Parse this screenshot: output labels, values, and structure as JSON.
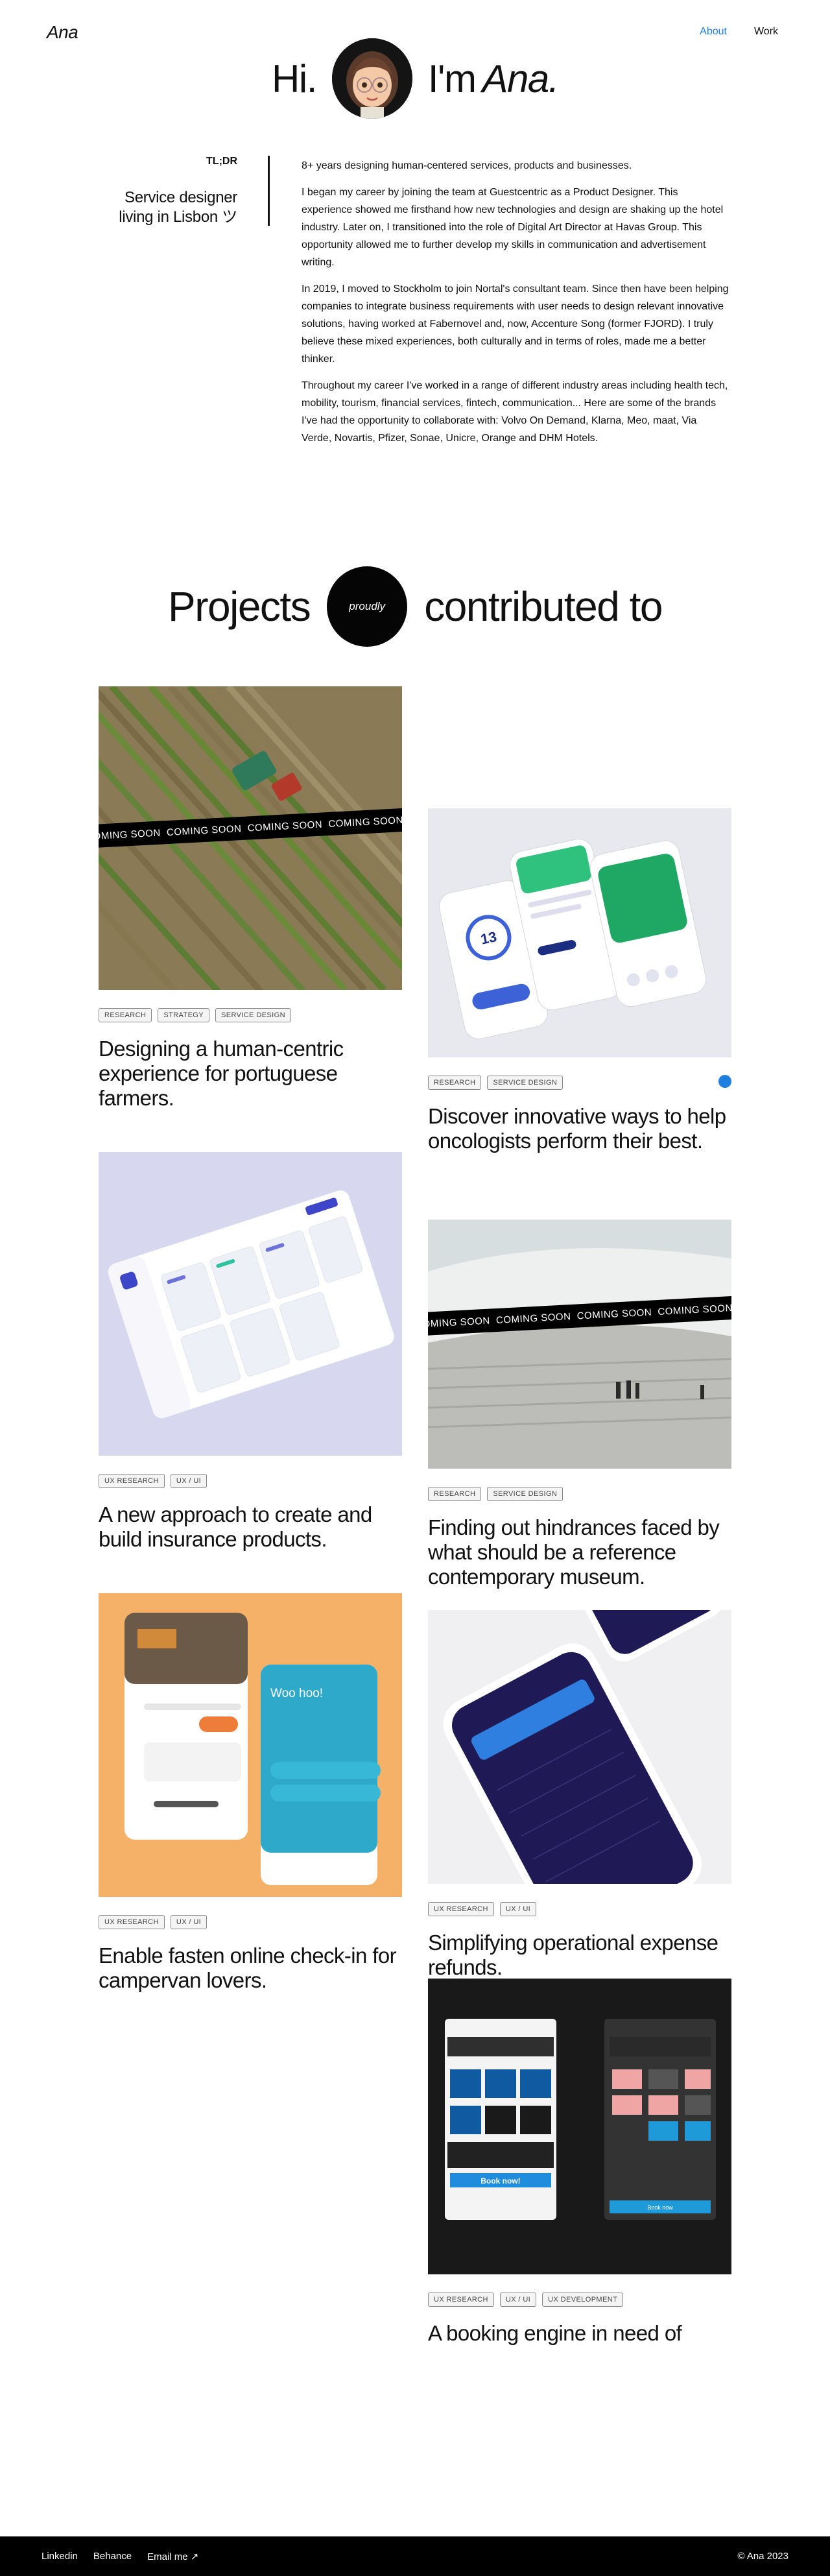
{
  "header": {
    "logo": "Ana",
    "nav": [
      {
        "label": "About",
        "active": true
      },
      {
        "label": "Work",
        "active": false
      }
    ]
  },
  "hero": {
    "greeting": "Hi.",
    "intro": "I'm",
    "name": "Ana."
  },
  "tldr": {
    "label": "TL;DR",
    "title": "Service designer living in Lisbon ツ",
    "paragraphs": [
      "8+ years designing human-centered services, products and businesses.",
      "I began my career by joining the team at Guestcentric as a Product Designer. This experience showed me firsthand how new technologies and design are shaking up the hotel industry. Later on, I transitioned into the role of Digital Art Director at Havas Group. This opportunity allowed me to further develop my skills in communication and advertisement writing.",
      "In 2019, I moved to Stockholm to join Nortal's consultant team. Since then have been helping companies to integrate business requirements with user needs to design relevant innovative solutions, having worked at Fabernovel and, now, Accenture Song (former FJORD). I truly believe these mixed experiences, both culturally and in terms of roles, made me a better thinker.",
      "Throughout my career I've worked in a range of different industry areas including health tech, mobility, tourism, financial services, fintech, communication... Here are some of the brands I've had the opportunity to collaborate with: Volvo On Demand, Klarna, Meo, maat, Via Verde, Novartis, Pfizer, Sonae, Unicre, Orange and DHM Hotels."
    ]
  },
  "projects_heading": {
    "left": "Projects",
    "badge": "proudly",
    "right": "contributed to"
  },
  "ribbon_text": "COMING SOON",
  "projects": [
    {
      "title": "Designing a human-centric experience for portuguese farmers.",
      "tags": [
        "RESEARCH",
        "STRATEGY",
        "SERVICE DESIGN"
      ]
    },
    {
      "title": "Discover innovative ways to help oncologists perform their best.",
      "tags": [
        "RESEARCH",
        "SERVICE DESIGN"
      ]
    },
    {
      "title": "A new approach to create and build insurance products.",
      "tags": [
        "UX RESEARCH",
        "UX / UI"
      ]
    },
    {
      "title": "Finding out hindrances faced by what should be a reference contemporary museum.",
      "tags": [
        "RESEARCH",
        "SERVICE DESIGN"
      ]
    },
    {
      "title": "Enable fasten online check-in for campervan lovers.",
      "tags": [
        "UX RESEARCH",
        "UX / UI"
      ]
    },
    {
      "title": "Simplifying operational expense refunds.",
      "tags": [
        "UX RESEARCH",
        "UX / UI"
      ]
    },
    {
      "title": "A booking engine in need of",
      "tags": [
        "UX RESEARCH",
        "UX / UI",
        "UX DEVELOPMENT"
      ]
    }
  ],
  "mockup_text": {
    "oncology_number": "13",
    "checkin_title": "Woo hoo!",
    "booking_cta": "Book now!",
    "booking_cta_alt": "Book now"
  },
  "footer": {
    "links": [
      "Linkedin",
      "Behance",
      "Email me ↗"
    ],
    "copyright": "© Ana 2023"
  },
  "colors": {
    "accent": "#1f7fe0",
    "background": "#ffffff",
    "footer": "#000000"
  }
}
